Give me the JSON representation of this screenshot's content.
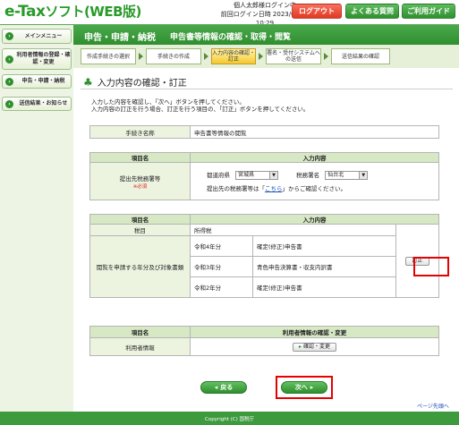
{
  "header": {
    "logo_main": "e-Tax",
    "logo_sub": "ソフト(WEB版)",
    "user_line1": "個人太郎様ログイン中",
    "user_line2": "前回ログイン日時 2023/05/01 10:29",
    "logout_label": "ログアウト",
    "faq_label": "よくある質問",
    "guide_label": "ご利用ガイド"
  },
  "sidebar": {
    "items": [
      {
        "label": "メインメニュー"
      },
      {
        "label": "利用者情報の登録・確認・変更"
      },
      {
        "label": "申告・申請・納税"
      },
      {
        "label": "送信結果・お知らせ"
      }
    ]
  },
  "title": {
    "main": "申告・申請・納税",
    "sub": "申告書等情報の確認・取得・閲覧"
  },
  "steps": [
    {
      "label": "作成手続きの選択"
    },
    {
      "label": "手続きの作成"
    },
    {
      "label": "入力内容の確認・訂正"
    },
    {
      "label": "署名・受付システムへの送信"
    },
    {
      "label": "送信結果の確認"
    }
  ],
  "section": {
    "title": "入力内容の確認・訂正",
    "intro_line1": "入力した内容を確認し、「次へ」ボタンを押してください。",
    "intro_line2": "入力内容の訂正を行う場合、訂正を行う項目の、「訂正」ボタンを押してください。"
  },
  "table1": {
    "label": "手続き名称",
    "value": "申告書等情報の閲覧"
  },
  "table2": {
    "col1": "項目名",
    "col2": "入力内容",
    "row_label": "提出先税務署等",
    "required": "※必須",
    "pref_label": "都道府県",
    "pref_value": "宮城県",
    "office_label": "税務署名",
    "office_value": "仙台北",
    "note_pre": "提出先の税務署等は「",
    "note_link": "こちら",
    "note_post": "」からご確認ください。"
  },
  "table3": {
    "col1": "項目名",
    "col2": "入力内容",
    "tax_label": "税目",
    "tax_value": "所得税",
    "years_label": "閲覧を申請する年分及び対象書類",
    "rows": [
      {
        "year": "令和4年分",
        "doc": "確定(修正)申告書"
      },
      {
        "year": "令和3年分",
        "doc": "青色申告決算書・収支内訳書"
      },
      {
        "year": "令和2年分",
        "doc": "確定(修正)申告書"
      }
    ],
    "correct_label": "訂正"
  },
  "table4": {
    "col1": "項目名",
    "col2": "利用者情報の確認・変更",
    "row_label": "利用者情報",
    "btn_label": "確認・変更"
  },
  "buttons": {
    "back": "戻る",
    "next": "次へ"
  },
  "pagetop": "ページ先頭へ",
  "footer": "Copyright (C) 国税庁"
}
